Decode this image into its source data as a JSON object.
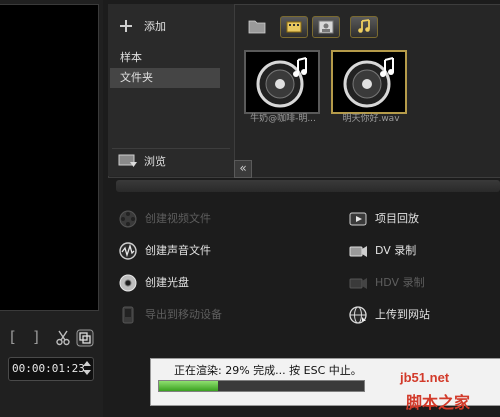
{
  "library": {
    "add_label": "添加",
    "sidebar_items": [
      "样本",
      "文件夹"
    ],
    "selected_item": "文件夹",
    "browse_label": "浏览",
    "collapse_glyph": "«",
    "toolbar_icons": [
      "folder-icon",
      "video-filter-icon",
      "photo-filter-icon",
      "audio-filter-icon"
    ],
    "thumbnails": [
      {
        "label": "牛奶@咖啡-明...",
        "icon": "music-note-icon",
        "selected": false
      },
      {
        "label": "明天你好.wav",
        "icon": "music-note-icon",
        "selected": true
      }
    ]
  },
  "preview": {
    "bracket_open": "[",
    "bracket_close": "]",
    "timecode": "00:00:01:23"
  },
  "actions": {
    "left": [
      {
        "label": "创建视频文件",
        "icon": "film-reel-icon",
        "enabled": false
      },
      {
        "label": "创建声音文件",
        "icon": "audio-wave-icon",
        "enabled": true
      },
      {
        "label": "创建光盘",
        "icon": "disc-icon",
        "enabled": true
      },
      {
        "label": "导出到移动设备",
        "icon": "mobile-device-icon",
        "enabled": false
      }
    ],
    "right": [
      {
        "label": "项目回放",
        "icon": "playback-icon",
        "enabled": true
      },
      {
        "label": "DV 录制",
        "icon": "dv-camera-icon",
        "enabled": true
      },
      {
        "label": "HDV 录制",
        "icon": "hdv-camera-icon",
        "enabled": false
      },
      {
        "label": "上传到网站",
        "icon": "globe-upload-icon",
        "enabled": true
      }
    ]
  },
  "render_progress": {
    "text": "正在渲染: 29% 完成... 按 ESC 中止。",
    "percent": 29
  },
  "watermark": {
    "site": "jb51.net",
    "home": "脚本之家"
  },
  "colors": {
    "accent_gold": "#b59b4a",
    "progress_green": "#3aa020",
    "watermark_red": "#d23a2a"
  }
}
